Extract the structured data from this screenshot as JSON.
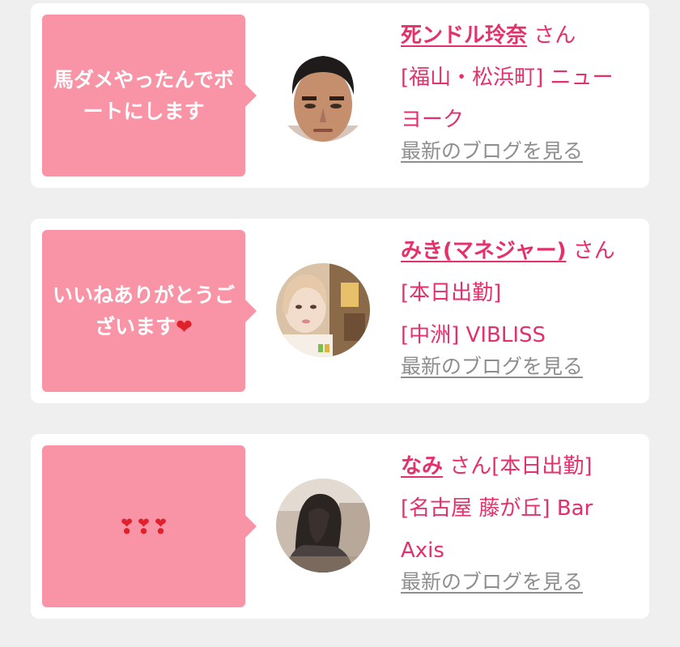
{
  "posts": [
    {
      "message": "馬ダメやったんでボートにします",
      "name": "死ンドル玲奈",
      "suffix": " さん",
      "detail": "[福山・松浜町] ニューヨーク",
      "blog_link": "最新のブログを見る",
      "avatar": "man-face-photo"
    },
    {
      "message": "いいねありがとうございます",
      "message_emoji": "❤",
      "name": "みき(マネジャー)",
      "suffix": " さん[本日出勤]",
      "detail": "[中洲] VIBLISS",
      "blog_link": "最新のブログを見る",
      "avatar": "woman-selfie-photo"
    },
    {
      "message": "❣❣❣",
      "name": "なみ",
      "suffix": " さん[本日出勤]",
      "detail": "[名古屋 藤が丘] Bar Axis",
      "blog_link": "最新のブログを見る",
      "avatar": "woman-long-hair-photo"
    }
  ]
}
